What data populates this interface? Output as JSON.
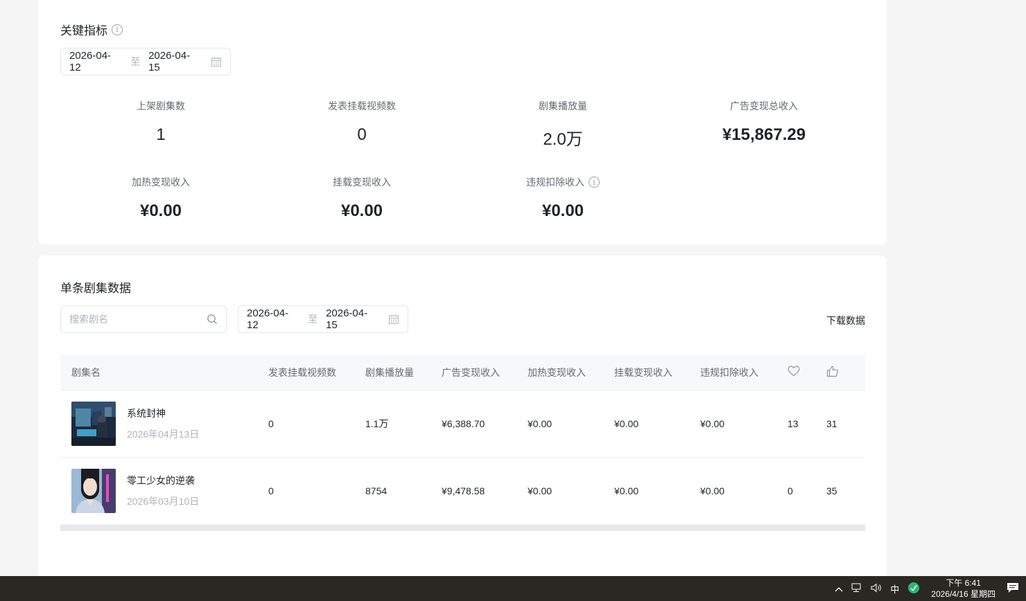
{
  "kpi": {
    "title": "关键指标",
    "date_start": "2026-04-12",
    "date_sep": "至",
    "date_end": "2026-04-15",
    "metrics": [
      {
        "label": "上架剧集数",
        "value": "1"
      },
      {
        "label": "发表挂载视频数",
        "value": "0"
      },
      {
        "label": "剧集播放量",
        "value": "2.0万"
      },
      {
        "label": "广告变现总收入",
        "value": "¥15,867.29"
      },
      {
        "label": "加热变现收入",
        "value": "¥0.00"
      },
      {
        "label": "挂载变现收入",
        "value": "¥0.00"
      },
      {
        "label": "违规扣除收入",
        "value": "¥0.00"
      }
    ]
  },
  "list": {
    "title": "单条剧集数据",
    "search_placeholder": "搜索剧名",
    "date_start": "2026-04-12",
    "date_sep": "至",
    "date_end": "2026-04-15",
    "download": "下载数据",
    "columns": [
      "剧集名",
      "发表挂载视频数",
      "剧集播放量",
      "广告变现收入",
      "加热变现收入",
      "挂载变现收入",
      "违规扣除收入"
    ],
    "rows": [
      {
        "title": "系统封神",
        "date": "2026年04月13日",
        "videos": "0",
        "plays": "1.1万",
        "ad": "¥6,388.70",
        "heat": "¥0.00",
        "mount": "¥0.00",
        "deduct": "¥0.00",
        "fav": "13",
        "like": "31"
      },
      {
        "title": "零工少女的逆袭",
        "date": "2026年03月10日",
        "videos": "0",
        "plays": "8754",
        "ad": "¥9,478.58",
        "heat": "¥0.00",
        "mount": "¥0.00",
        "deduct": "¥0.00",
        "fav": "0",
        "like": "35"
      }
    ]
  },
  "taskbar": {
    "ime": "中",
    "time": "下午 6:41",
    "date": "2026/4/16 星期四"
  },
  "icons": {
    "info": "info-icon",
    "calendar": "calendar-icon",
    "search": "search-icon",
    "heart": "heart-icon",
    "thumb": "thumbs-up-icon"
  }
}
